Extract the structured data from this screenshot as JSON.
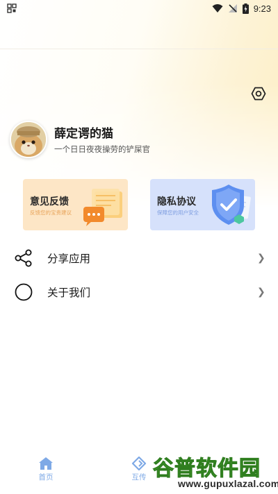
{
  "status_bar": {
    "time": "9:23",
    "icons": [
      "qr-app-icon",
      "wifi-icon",
      "no-signal-icon",
      "battery-charging-icon"
    ]
  },
  "profile": {
    "name": "薛定谔的猫",
    "bio": "一个日日夜夜操劳的铲屎官"
  },
  "cards": {
    "feedback": {
      "title": "意见反馈",
      "subtitle": "反馈您的宝贵建议"
    },
    "privacy": {
      "title": "隐私协议",
      "subtitle": "保障您的用户安全"
    }
  },
  "menu": [
    {
      "label": "分享应用",
      "icon": "share-icon"
    },
    {
      "label": "关于我们",
      "icon": "circle-info-icon"
    }
  ],
  "bottom_nav": [
    {
      "label": "首页",
      "icon": "home-icon"
    },
    {
      "label": "互传",
      "icon": "transfer-icon"
    }
  ],
  "watermark": {
    "cn": "谷普软件园",
    "en": "www.gupuxlazal.com"
  },
  "colors": {
    "accent_blue": "#7ea9e6",
    "feedback_bg": "#fde6c6",
    "privacy_bg": "#d6e1fb",
    "watermark_green": "#55b836"
  }
}
